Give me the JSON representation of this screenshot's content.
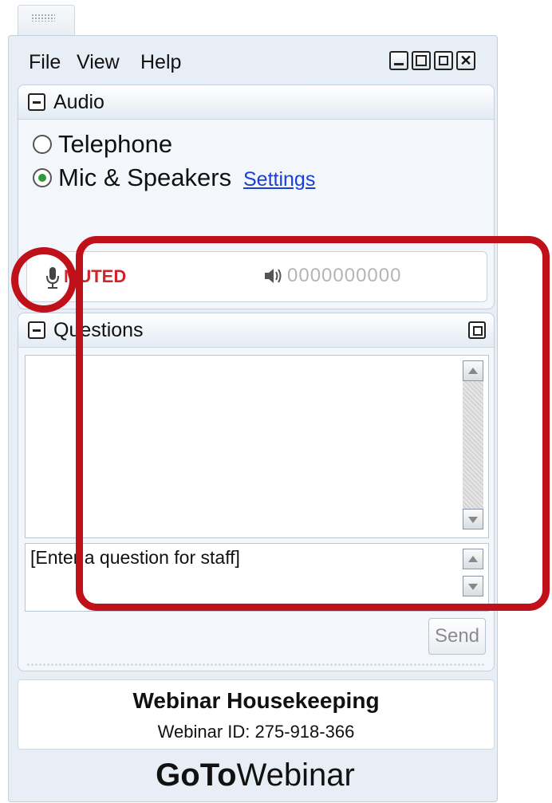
{
  "menu": {
    "file": "File",
    "view": "View",
    "help": "Help"
  },
  "window_controls": [
    "minimize-icon",
    "maximize-icon",
    "restore-icon",
    "close-icon"
  ],
  "audio": {
    "title": "Audio",
    "options": [
      {
        "label": "Telephone",
        "selected": false
      },
      {
        "label": "Mic & Speakers",
        "selected": true
      }
    ],
    "settings_link": "Settings",
    "mic_status": "MUTED",
    "level_meter": "0000000000"
  },
  "questions": {
    "title": "Questions",
    "input_placeholder": "[Enter a question for staff]",
    "send_label": "Send"
  },
  "footer": {
    "title": "Webinar Housekeeping",
    "webinar_id": "Webinar ID: 275-918-366"
  },
  "brand": {
    "bold": "GoTo",
    "light": "Webinar"
  },
  "colors": {
    "muted_red": "#d2232a",
    "link_blue": "#1a3fd6",
    "annotation_red": "#c0101a",
    "radio_green": "#2e9b3a"
  }
}
